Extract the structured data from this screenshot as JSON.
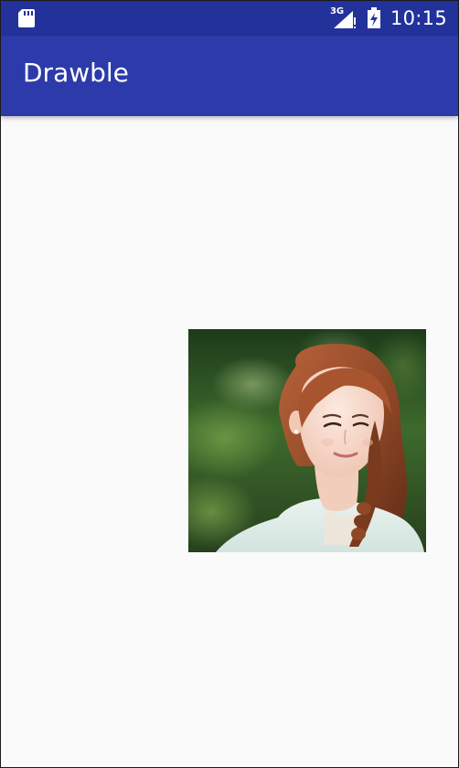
{
  "status_bar": {
    "network_type": "3G",
    "time": "10:15",
    "icons": [
      "sd-card-icon",
      "signal-icon",
      "battery-charging-icon"
    ]
  },
  "app_bar": {
    "title": "Drawble"
  },
  "content": {
    "image": {
      "subject": "portrait-photo"
    }
  },
  "colors": {
    "status_bar": "#23329a",
    "app_bar": "#2c3ba9",
    "background": "#fafafa"
  }
}
